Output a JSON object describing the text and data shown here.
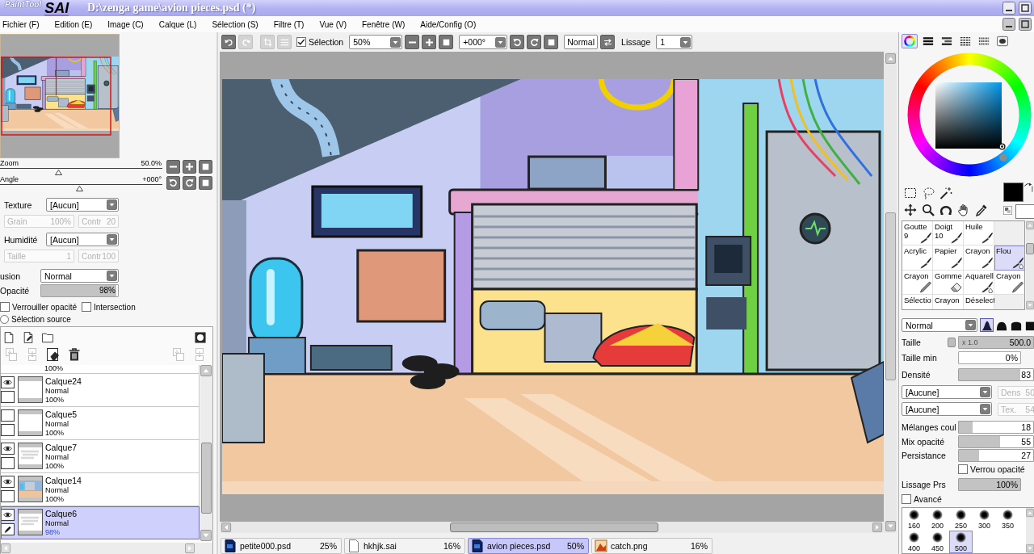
{
  "window": {
    "logo_small": "PaintTool",
    "logo_large": "SAI",
    "title": "D:\\zenga game\\avion pieces.psd (*)"
  },
  "menu": [
    "Fichier (F)",
    "Edition (E)",
    "Image (C)",
    "Calque (L)",
    "Sélection (S)",
    "Filtre (T)",
    "Vue (V)",
    "Fenêtre (W)",
    "Aide/Config (O)"
  ],
  "navigator": {
    "zoom": {
      "label": "Zoom",
      "value": "50.0%",
      "level": 0.36
    },
    "angle": {
      "label": "Angle",
      "value": "+000°",
      "level": 0.49
    }
  },
  "brush_texture": [
    {
      "label": "Texture",
      "value": "[Aucun]",
      "fields": [
        {
          "label": "Grain",
          "value": "100%",
          "disabled": true
        },
        {
          "label": "Contr",
          "value": "20",
          "disabled": true
        }
      ]
    },
    {
      "label": "Humidité",
      "value": "[Aucun]",
      "fields": [
        {
          "label": "Taille",
          "value": "1",
          "disabled": true
        },
        {
          "label": "Contr",
          "value": "100",
          "disabled": true
        }
      ]
    }
  ],
  "layer_properties": {
    "blend": {
      "label": "usion",
      "value": "Normal"
    },
    "opacity": {
      "label": "Opacité",
      "value": "98%",
      "level": 0.98
    },
    "checkboxes": [
      {
        "label": "Verrouiller opacité",
        "checked": false
      },
      {
        "label": "Intersection",
        "checked": false
      }
    ],
    "source": {
      "label": "Sélection source",
      "selected": false
    }
  },
  "layers": {
    "toolbar": [
      {
        "left": [
          {
            "kind": "page",
            "disabled": false
          },
          {
            "kind": "page-pen",
            "disabled": false
          },
          {
            "kind": "folder",
            "disabled": false
          }
        ],
        "right": [
          {
            "kind": "mask",
            "disabled": false
          }
        ]
      },
      {
        "left": [
          {
            "kind": "pages-down",
            "disabled": true
          },
          {
            "kind": "pages-merge",
            "disabled": true
          },
          {
            "kind": "clear",
            "disabled": false
          },
          {
            "kind": "trash",
            "disabled": false
          }
        ],
        "right": [
          {
            "kind": "pages-down",
            "disabled": true
          },
          {
            "kind": "pages-merge",
            "disabled": true
          }
        ]
      }
    ],
    "items": [
      {
        "opacity": "100%",
        "selected": false
      },
      {
        "name": "Calque24",
        "mode": "Normal",
        "opacity": "100%",
        "visible": true,
        "selected": false,
        "kind": "blank"
      },
      {
        "name": "Calque5",
        "mode": "Normal",
        "opacity": "100%",
        "visible": false,
        "selected": false,
        "kind": "blank"
      },
      {
        "name": "Calque7",
        "mode": "Normal",
        "opacity": "100%",
        "visible": true,
        "selected": false,
        "kind": "sketch"
      },
      {
        "name": "Calque14",
        "mode": "Normal",
        "opacity": "100%",
        "visible": true,
        "selected": false,
        "kind": "scene"
      },
      {
        "name": "Calque6",
        "mode": "Normal",
        "opacity": "98%",
        "visible": true,
        "selected": true,
        "kind": "sketch"
      }
    ]
  },
  "canvas_toolbar": [
    {
      "kind": "undo",
      "disabled": false
    },
    {
      "kind": "redo",
      "disabled": true
    },
    {
      "kind": "crop",
      "disabled": true
    },
    {
      "kind": "lines",
      "disabled": true
    },
    {
      "kind": "checkbox",
      "label": "Sélection",
      "checked": true
    },
    {
      "kind": "dropdown",
      "value": "50%"
    },
    {
      "kind": "minus",
      "disabled": false
    },
    {
      "kind": "plus",
      "disabled": false
    },
    {
      "kind": "reset",
      "disabled": false
    },
    {
      "kind": "dropdown",
      "value": "+000°"
    },
    {
      "kind": "rotate-left",
      "disabled": false
    },
    {
      "kind": "rotate-right",
      "disabled": false
    },
    {
      "kind": "reset",
      "disabled": false
    },
    {
      "kind": "text-button",
      "label": "Normal"
    },
    {
      "kind": "flip",
      "disabled": false
    },
    {
      "kind": "label",
      "label": "Lissage"
    },
    {
      "kind": "dropdown",
      "value": "1"
    }
  ],
  "document_tabs": [
    {
      "name": "petite000.psd",
      "zoom": "25%",
      "kind": "psd",
      "selected": false
    },
    {
      "name": "hkhjk.sai",
      "zoom": "16%",
      "kind": "sai",
      "selected": false
    },
    {
      "name": "avion pieces.psd",
      "zoom": "50%",
      "kind": "psd",
      "selected": true
    },
    {
      "name": "catch.png",
      "zoom": "16%",
      "kind": "png",
      "selected": false
    }
  ],
  "color_tabs": [
    {
      "kind": "wheel",
      "selected": true
    },
    {
      "kind": "rgb",
      "selected": false
    },
    {
      "kind": "hsv",
      "selected": false
    },
    {
      "kind": "swatches",
      "selected": false
    },
    {
      "kind": "grid",
      "selected": false
    },
    {
      "kind": "scratch",
      "selected": false
    }
  ],
  "swatches": {
    "primary": {
      "color": "#000000"
    },
    "secondary": {
      "color": "#ffffff"
    }
  },
  "tools": [
    [
      {
        "kind": "rect-select"
      },
      {
        "kind": "lasso"
      },
      {
        "kind": "wand"
      }
    ],
    [
      {
        "kind": "move"
      },
      {
        "kind": "zoom"
      },
      {
        "kind": "rotate"
      },
      {
        "kind": "hand"
      },
      {
        "kind": "eyedropper"
      }
    ]
  ],
  "brushes": [
    {
      "name": "Goutte",
      "size": "9",
      "kind": "brush",
      "selected": false
    },
    {
      "name": "Doigt",
      "size": "10",
      "kind": "brush",
      "selected": false
    },
    {
      "name": "Huile",
      "kind": "brush",
      "selected": false
    },
    {
      "kind": "empty"
    },
    {
      "name": "Acrylic",
      "kind": "brush",
      "selected": false
    },
    {
      "name": "Papier",
      "kind": "brush",
      "selected": false
    },
    {
      "name": "Crayon",
      "kind": "brush",
      "selected": false
    },
    {
      "name": "Flou",
      "kind": "blur",
      "selected": true
    },
    {
      "name": "Crayon",
      "kind": "pencil",
      "selected": false
    },
    {
      "name": "Gomme",
      "kind": "eraser",
      "selected": false
    },
    {
      "name": "Aquarell",
      "kind": "water",
      "selected": false
    },
    {
      "name": "Crayon",
      "kind": "pencil",
      "selected": false
    },
    {
      "name": "Sélectio",
      "selected": false
    },
    {
      "name": "Crayon",
      "selected": false
    },
    {
      "name": "Déselect",
      "selected": false
    },
    {
      "kind": "empty"
    }
  ],
  "brush_settings": {
    "blend": "Normal",
    "shapes": [
      {
        "kind": "soft",
        "selected": true
      },
      {
        "kind": "round",
        "selected": false
      },
      {
        "kind": "flat",
        "selected": false
      },
      {
        "kind": "square",
        "selected": false
      }
    ],
    "size": {
      "label": "Taille",
      "multiplier": "x 1.0",
      "value": "500.0",
      "level": 1
    },
    "min_size": {
      "label": "Taille min",
      "value": "0%"
    },
    "density": {
      "label": "Densité",
      "value": "83",
      "level": 0.83
    },
    "textures": [
      {
        "value": "[Aucune]",
        "field": {
          "label": "Dens",
          "value": "50",
          "disabled": true
        }
      },
      {
        "value": "[Aucune]",
        "field": {
          "label": "Tex.",
          "value": "54",
          "disabled": true
        }
      }
    ],
    "mix": [
      {
        "label": "Mélanges coul",
        "value": "18",
        "level": 0.18
      },
      {
        "label": "Mix opacité",
        "value": "55",
        "level": 0.55
      },
      {
        "label": "Persistance",
        "value": "27",
        "level": 0.27
      }
    ],
    "lock_opacity": {
      "label": "Verrou opacité",
      "checked": false
    },
    "pressure_smoothing": {
      "label": "Lissage Prs",
      "value": "100%",
      "level": 1
    },
    "advanced": {
      "label": "Avancé",
      "checked": false
    },
    "presets": [
      {
        "size": "160",
        "selected": false
      },
      {
        "size": "200",
        "selected": false
      },
      {
        "size": "250",
        "selected": false
      },
      {
        "size": "300",
        "selected": false
      },
      {
        "size": "350",
        "selected": false
      },
      {
        "size": "400",
        "selected": false
      },
      {
        "size": "450",
        "selected": false
      },
      {
        "size": "500",
        "selected": true
      }
    ]
  }
}
